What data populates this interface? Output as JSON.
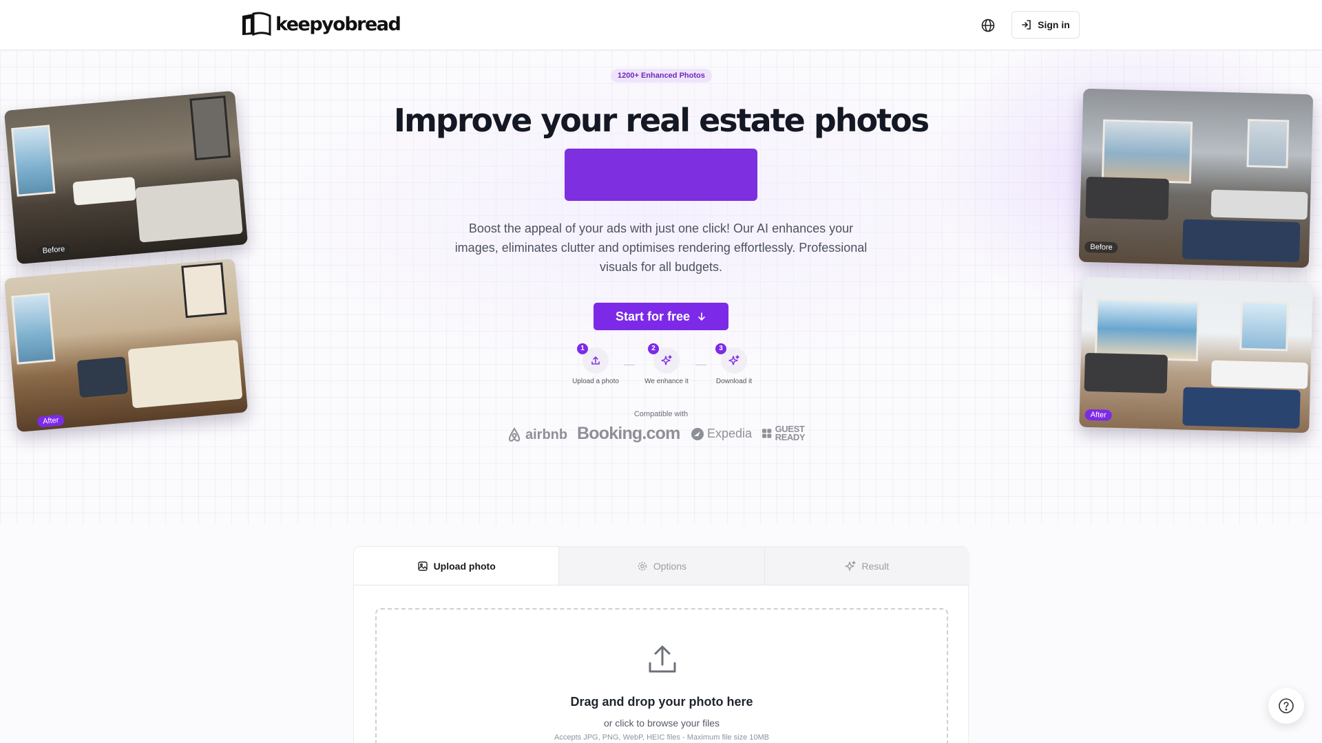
{
  "header": {
    "brand": "keepyobread",
    "signin_label": "Sign in"
  },
  "hero": {
    "badge": "1200+ Enhanced Photos",
    "title": "Improve your real estate photos",
    "description": "Boost the appeal of your ads with just one click! Our AI enhances your images, eliminates clutter and optimises rendering effortlessly. Professional visuals for all budgets.",
    "cta_label": "Start for free"
  },
  "steps": [
    {
      "num": "1",
      "label": "Upload a photo",
      "icon": "upload-icon"
    },
    {
      "num": "2",
      "label": "We enhance it",
      "icon": "sparkles-icon"
    },
    {
      "num": "3",
      "label": "Download it",
      "icon": "sparkles-icon"
    }
  ],
  "compatible": {
    "label": "Compatible with",
    "partners": [
      "airbnb",
      "Booking.com",
      "Expedia",
      "GUEST READY"
    ]
  },
  "photos": {
    "left_before": "Before",
    "left_after": "After",
    "right_before": "Before",
    "right_after": "After"
  },
  "upload": {
    "tabs": [
      "Upload photo",
      "Options",
      "Result"
    ],
    "active_tab": "Upload photo",
    "drop_title": "Drag and drop your photo here",
    "drop_sub": "or click to browse your files",
    "drop_hint": "Accepts JPG, PNG, WebP, HEIC files - Maximum file size 10MB"
  },
  "colors": {
    "accent": "#7d2ae8",
    "badge_bg": "#efe4fb",
    "text": "#141824"
  }
}
